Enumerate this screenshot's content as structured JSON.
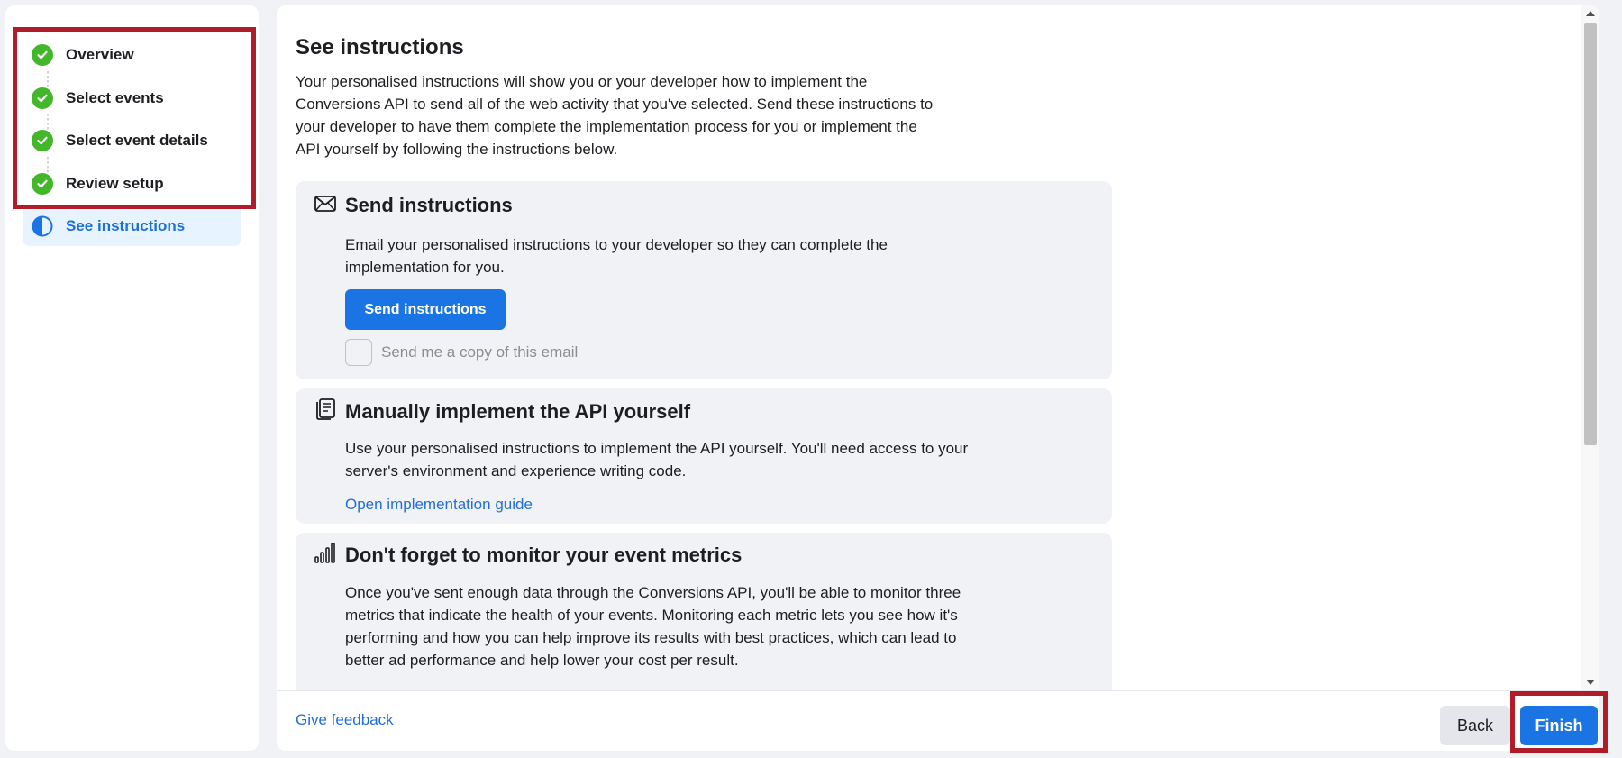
{
  "steps": [
    {
      "label": "Overview",
      "status": "complete"
    },
    {
      "label": "Select events",
      "status": "complete"
    },
    {
      "label": "Select event details",
      "status": "complete"
    },
    {
      "label": "Review setup",
      "status": "complete"
    },
    {
      "label": "See instructions",
      "status": "current"
    }
  ],
  "main": {
    "title": "See instructions",
    "intro": "Your personalised instructions will show you or your developer how to implement the Conversions API to send all of the web activity that you've selected. Send these instructions to your developer to have them complete the implementation process for you or implement the API yourself by following the instructions below.",
    "send_card": {
      "icon": "envelope-icon",
      "title": "Send instructions",
      "body": "Email your personalised instructions to your developer so they can complete the implementation for you.",
      "button_label": "Send instructions",
      "checkbox_label": "Send me a copy of this email",
      "checkbox_checked": false
    },
    "manual_card": {
      "icon": "document-icon",
      "title": "Manually implement the API yourself",
      "body": "Use your personalised instructions to implement the API yourself. You'll need access to your server's environment and experience writing code.",
      "link_label": "Open implementation guide"
    },
    "metrics_card": {
      "icon": "bar-chart-icon",
      "title": "Don't forget to monitor your event metrics",
      "body": "Once you've sent enough data through the Conversions API, you'll be able to monitor three metrics that indicate the health of your events. Monitoring each metric lets you see how it's performing and how you can help improve its results with best practices, which can lead to better ad performance and help lower your cost per result."
    }
  },
  "footer": {
    "feedback_label": "Give feedback",
    "back_label": "Back",
    "finish_label": "Finish"
  },
  "colors": {
    "accent": "#1b74e4",
    "success": "#42b72a",
    "highlight": "#b01c28",
    "active_step_bg": "#e7f3ff"
  }
}
